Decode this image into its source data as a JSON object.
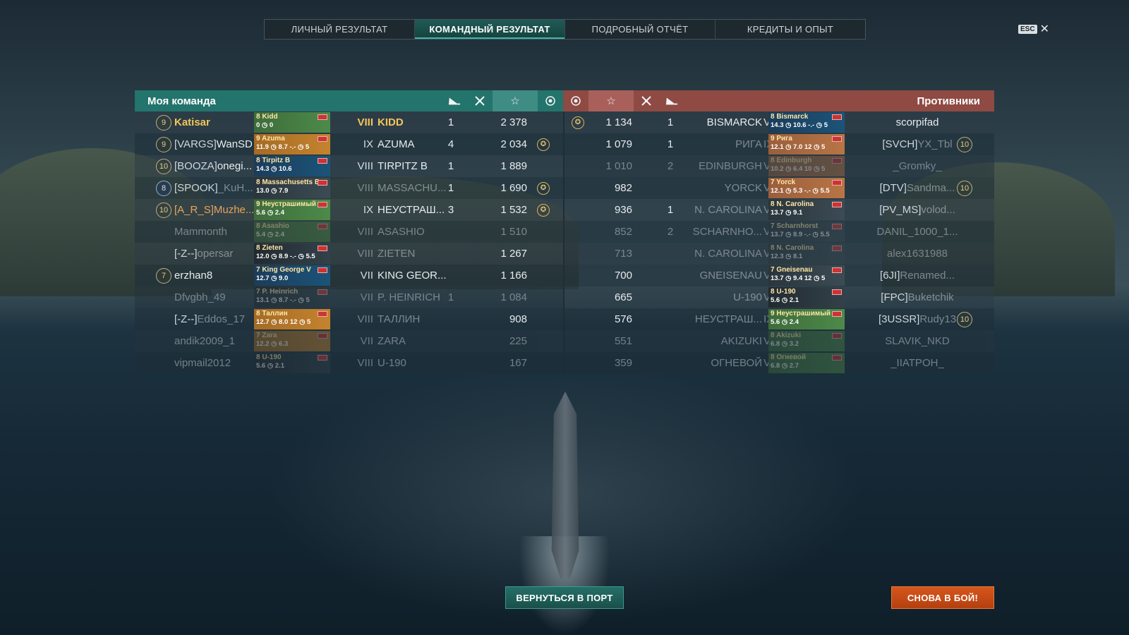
{
  "tabs": [
    {
      "label": "ЛИЧНЫЙ РЕЗУЛЬТАТ",
      "active": false
    },
    {
      "label": "КОМАНДНЫЙ РЕЗУЛЬТАТ",
      "active": true
    },
    {
      "label": "ПОДРОБНЫЙ ОТЧЁТ",
      "active": false
    },
    {
      "label": "КРЕДИТЫ И ОПЫТ",
      "active": false
    }
  ],
  "esc": {
    "key": "ESC",
    "close": "✕"
  },
  "my_team": {
    "title": "Моя команда",
    "header_icons": [
      "ship-sunk-icon",
      "planes-destroyed-icon",
      "star-icon",
      "medal-icon"
    ],
    "rows": [
      {
        "rank": "9",
        "clan": "",
        "nick": "Katisar",
        "card_title": "8 Kidd",
        "card_stats": "0 ◷ 0",
        "card_color": "green",
        "tier": "VIII",
        "ship": "KIDD",
        "kills": "1",
        "xp": "2 378",
        "medal": false,
        "state": "me"
      },
      {
        "rank": "9",
        "clan": "[VARGS]",
        "nick": "WanSD",
        "card_title": "9 Azuma",
        "card_stats": "11.9 ◷ 8.7   -.- ◷ 5",
        "card_color": "orange",
        "tier": "IX",
        "ship": "AZUMA",
        "kills": "4",
        "xp": "2 034",
        "medal": true,
        "state": "alive"
      },
      {
        "rank": "10",
        "clan": "[BOOZA]",
        "nick": "onegi...",
        "card_title": "8 Tirpitz B",
        "card_stats": "14.3 ◷ 10.6",
        "card_color": "blue",
        "tier": "VIII",
        "ship": "TIRPITZ B",
        "kills": "1",
        "xp": "1 889",
        "medal": false,
        "state": "alive"
      },
      {
        "rank": "8",
        "clan": "[SPOOK]",
        "nick": "_KuH...",
        "card_title": "8 Massachusetts B",
        "card_stats": "13.0 ◷ 7.9",
        "card_color": "gray",
        "tier": "VIII",
        "ship": "MASSACHU...",
        "kills": "1",
        "xp": "1 690",
        "medal": true,
        "state": "partial",
        "rank_blue": true
      },
      {
        "rank": "10",
        "clan": "[A_R_S]",
        "nick": "Muzhe...",
        "card_title": "9 Неустрашимый",
        "card_stats": "5.6 ◷ 2.4",
        "card_color": "green",
        "tier": "IX",
        "ship": "НЕУСТРАШ...",
        "kills": "3",
        "xp": "1 532",
        "medal": true,
        "state": "orange"
      },
      {
        "rank": "",
        "clan": "",
        "nick": "Mammonth",
        "card_title": "8 Asashio",
        "card_stats": "5.4 ◷ 2.4",
        "card_color": "green",
        "tier": "VIII",
        "ship": "ASASHIO",
        "kills": "",
        "xp": "1 510",
        "medal": false,
        "state": "dead"
      },
      {
        "rank": "",
        "clan": "[-Z--]",
        "nick": "opersar",
        "card_title": "8 Zieten",
        "card_stats": "12.0 ◷ 8.9   -.- ◷ 5.5",
        "card_color": "dark",
        "tier": "VIII",
        "ship": "ZIETEN",
        "kills": "",
        "xp": "1 267",
        "medal": false,
        "state": "partial"
      },
      {
        "rank": "7",
        "clan": "",
        "nick": "erzhan8",
        "card_title": "7 King George V",
        "card_stats": "12.7 ◷ 9.0",
        "card_color": "blue",
        "tier": "VII",
        "ship": "KING GEOR...",
        "kills": "",
        "xp": "1 166",
        "medal": false,
        "state": "alive"
      },
      {
        "rank": "",
        "clan": "",
        "nick": "Dfvgbh_49",
        "card_title": "7 P. Heinrich",
        "card_stats": "13.1 ◷ 8.7   -.- ◷ 5",
        "card_color": "dark",
        "tier": "VII",
        "ship": "P. HEINRICH",
        "kills": "1",
        "xp": "1 084",
        "medal": false,
        "state": "dead"
      },
      {
        "rank": "",
        "clan": "[-Z--]",
        "nick": "Eddos_17",
        "card_title": "8 Таллин",
        "card_stats": "12.7 ◷ 8.0   12 ◷ 5",
        "card_color": "orange",
        "tier": "VIII",
        "ship": "ТАЛЛИН",
        "kills": "",
        "xp": "908",
        "medal": false,
        "state": "partial"
      },
      {
        "rank": "",
        "clan": "",
        "nick": "andik2009_1",
        "card_title": "7 Zara",
        "card_stats": "12.2 ◷ 6.3",
        "card_color": "orange",
        "tier": "VII",
        "ship": "ZARA",
        "kills": "",
        "xp": "225",
        "medal": false,
        "state": "dead"
      },
      {
        "rank": "",
        "clan": "",
        "nick": "vipmail2012",
        "card_title": "8 U-190",
        "card_stats": "5.6 ◷ 2.1",
        "card_color": "dark",
        "tier": "VIII",
        "ship": "U-190",
        "kills": "",
        "xp": "167",
        "medal": false,
        "state": "dead"
      }
    ]
  },
  "enemy_team": {
    "title": "Противники",
    "header_icons": [
      "medal-icon",
      "star-icon",
      "planes-destroyed-icon",
      "ship-sunk-icon"
    ],
    "rows": [
      {
        "medal": true,
        "xp": "1 134",
        "kills": "1",
        "ship": "BISMARCK",
        "tier": "VIII",
        "card_title": "8 Bismarck",
        "card_stats": "14.3 ◷ 10.6   -.- ◷ 5",
        "card_color": "blue",
        "clan": "",
        "nick": "scorpifad",
        "rank": "",
        "state": "alive"
      },
      {
        "medal": false,
        "xp": "1 079",
        "kills": "1",
        "ship": "РИГА",
        "tier": "IX",
        "card_title": "9 Рига",
        "card_stats": "12.1 ◷ 7.0   12 ◷ 5",
        "card_color": "salmon",
        "clan": "[SVCH]",
        "nick": "YX_Tbl",
        "rank": "10",
        "state": "partial"
      },
      {
        "medal": false,
        "xp": "1 010",
        "kills": "2",
        "ship": "EDINBURGH",
        "tier": "VIII",
        "card_title": "8 Edinburgh",
        "card_stats": "10.2 ◷ 6.4   10 ◷ 5",
        "card_color": "salmon",
        "clan": "",
        "nick": "_Gromky_",
        "rank": "",
        "state": "dead"
      },
      {
        "medal": false,
        "xp": "982",
        "kills": "",
        "ship": "YORCK",
        "tier": "VII",
        "card_title": "7 Yorck",
        "card_stats": "12.1 ◷ 5.3   -.- ◷ 5.5",
        "card_color": "salmon",
        "clan": "[DTV]",
        "nick": "Sandma...",
        "rank": "10",
        "state": "partial"
      },
      {
        "medal": false,
        "xp": "936",
        "kills": "1",
        "ship": "N. CAROLINA",
        "tier": "VIII",
        "card_title": "8 N. Carolina",
        "card_stats": "13.7 ◷ 9.1",
        "card_color": "gray",
        "clan": "[PV_MS]",
        "nick": "volod...",
        "rank": "",
        "state": "partial"
      },
      {
        "medal": false,
        "xp": "852",
        "kills": "2",
        "ship": "SCHARNHO...",
        "tier": "VII",
        "card_title": "7 Scharnhorst",
        "card_stats": "13.7 ◷ 8.9   -.- ◷ 5.5",
        "card_color": "gray",
        "clan": "",
        "nick": "DANIL_1000_1...",
        "rank": "",
        "state": "dead"
      },
      {
        "medal": false,
        "xp": "713",
        "kills": "",
        "ship": "N. CAROLINA",
        "tier": "VIII",
        "card_title": "8 N. Carolina",
        "card_stats": "12.3 ◷ 8.1",
        "card_color": "gray",
        "clan": "",
        "nick": "alex1631988",
        "rank": "",
        "state": "dead"
      },
      {
        "medal": false,
        "xp": "700",
        "kills": "",
        "ship": "GNEISENAU",
        "tier": "VII",
        "card_title": "7 Gneisenau",
        "card_stats": "13.7 ◷ 9.4   12 ◷ 5",
        "card_color": "gray",
        "clan": "[6JI]",
        "nick": "Renamed...",
        "rank": "",
        "state": "partial"
      },
      {
        "medal": false,
        "xp": "665",
        "kills": "",
        "ship": "U-190",
        "tier": "VIII",
        "card_title": "8 U-190",
        "card_stats": "5.6 ◷ 2.1",
        "card_color": "dark",
        "clan": "[FPC]",
        "nick": "Buketchik",
        "rank": "",
        "state": "partial"
      },
      {
        "medal": false,
        "xp": "576",
        "kills": "",
        "ship": "НЕУСТРАШ...",
        "tier": "IX",
        "card_title": "9 Неустрашимый",
        "card_stats": "5.6 ◷ 2.4",
        "card_color": "green",
        "clan": "[3USSR]",
        "nick": "Rudy13",
        "rank": "10",
        "state": "partial"
      },
      {
        "medal": false,
        "xp": "551",
        "kills": "",
        "ship": "AKIZUKI",
        "tier": "VIII",
        "card_title": "8 Akizuki",
        "card_stats": "6.8 ◷ 3.2",
        "card_color": "green",
        "clan": "",
        "nick": "SLAVIK_NKD",
        "rank": "",
        "state": "dead"
      },
      {
        "medal": false,
        "xp": "359",
        "kills": "",
        "ship": "ОГНЕВОЙ",
        "tier": "VIII",
        "card_title": "8 Огневой",
        "card_stats": "6.8 ◷ 2.7",
        "card_color": "green",
        "clan": "",
        "nick": "_IIATPOH_",
        "rank": "",
        "state": "dead"
      }
    ]
  },
  "buttons": {
    "return_port": "ВЕРНУТЬСЯ В ПОРТ",
    "battle_again": "СНОВА В БОЙ!"
  }
}
